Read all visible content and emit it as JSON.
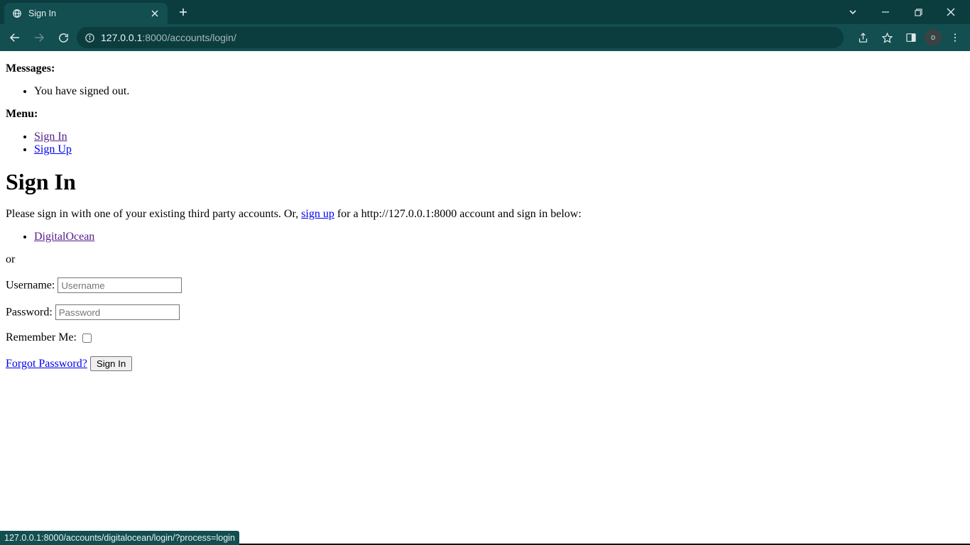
{
  "browser": {
    "tab_title": "Sign In",
    "url_host": "127.0.0.1",
    "url_port": ":8000",
    "url_path": "/accounts/login/",
    "avatar_initial": "o",
    "status_url": "127.0.0.1:8000/accounts/digitalocean/login/?process=login"
  },
  "messages": {
    "heading": "Messages:",
    "items": [
      "You have signed out."
    ]
  },
  "menu": {
    "heading": "Menu:",
    "items": [
      {
        "label": "Sign In"
      },
      {
        "label": "Sign Up"
      }
    ]
  },
  "page": {
    "title": "Sign In",
    "intro_before": "Please sign in with one of your existing third party accounts. Or, ",
    "intro_link": "sign up",
    "intro_after": " for a http://127.0.0.1:8000 account and sign in below:",
    "providers": [
      {
        "label": "DigitalOcean"
      }
    ],
    "or_text": "or"
  },
  "form": {
    "username_label": "Username:",
    "username_placeholder": "Username",
    "password_label": "Password:",
    "password_placeholder": "Password",
    "remember_label": "Remember Me:",
    "forgot_label": "Forgot Password?",
    "submit_label": "Sign In"
  }
}
